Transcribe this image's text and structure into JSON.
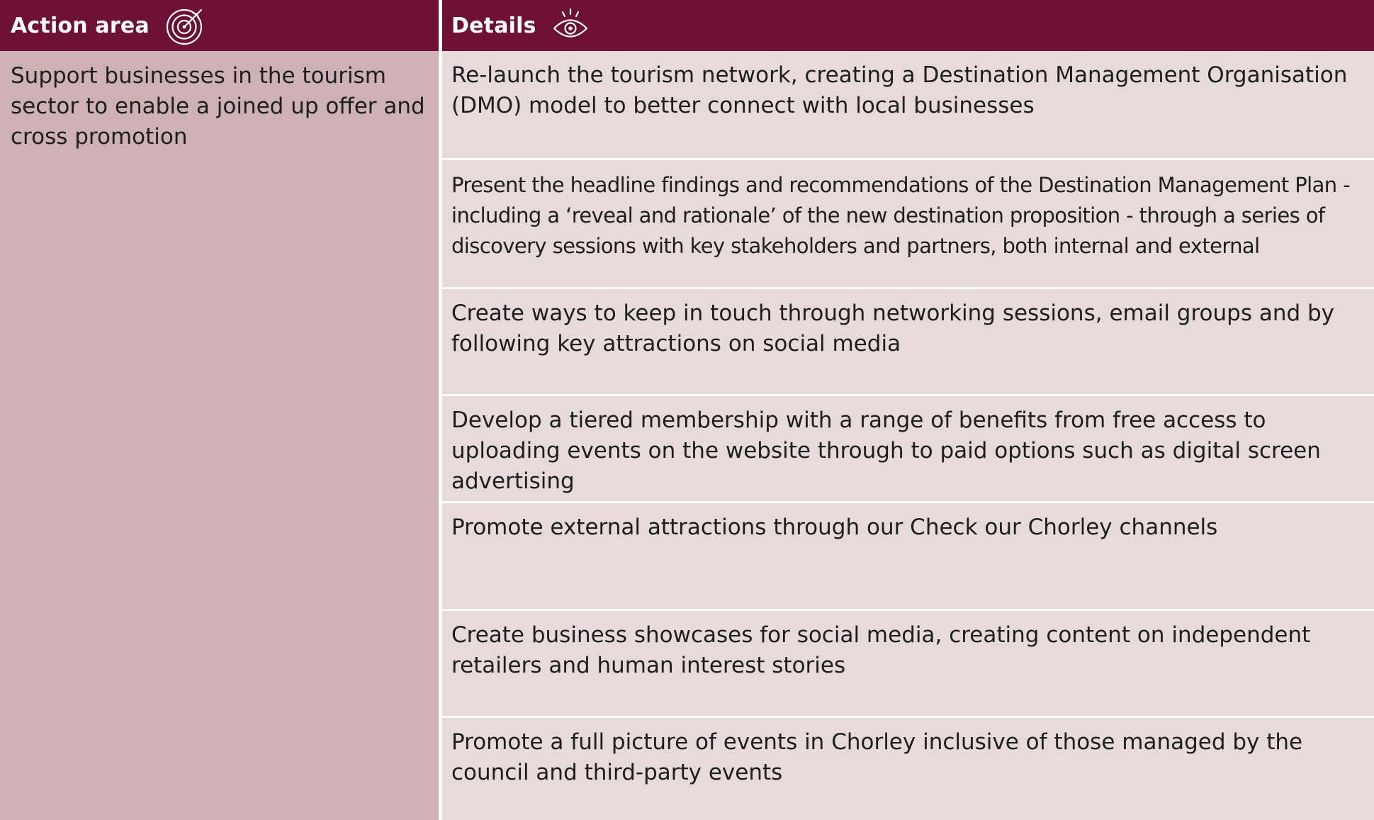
{
  "header": {
    "action_area_label": "Action area",
    "details_label": "Details",
    "action_area_icon": "target-icon",
    "details_icon": "eye-icon",
    "background_color": "#6e0f34"
  },
  "action_area": {
    "text": "Support businesses in the tourism sector to enable a joined up offer and cross promotion",
    "background_color": "#cdb1b4"
  },
  "details": {
    "background_color": "#e6dadb",
    "rows": [
      "Re-launch the tourism network, creating a Destination Management Organisation (DMO) model to better connect with local businesses",
      "Present the headline findings and recommendations of the Destination Management Plan - including a ‘reveal and rationale’ of the new destination proposition - through a series of discovery sessions with key stakeholders and partners, both internal and external",
      "Create ways to keep in touch through networking sessions, email groups and by following key attractions on social media",
      "Develop a tiered membership with a range of benefits from free access to uploading events on the website through to paid options such as digital screen advertising",
      "Promote external attractions through our Check our Chorley channels",
      "Create business showcases for social media, creating content on independent retailers and human interest stories",
      "Promote a full picture of events in Chorley inclusive of those managed by the council and third-party events"
    ]
  }
}
